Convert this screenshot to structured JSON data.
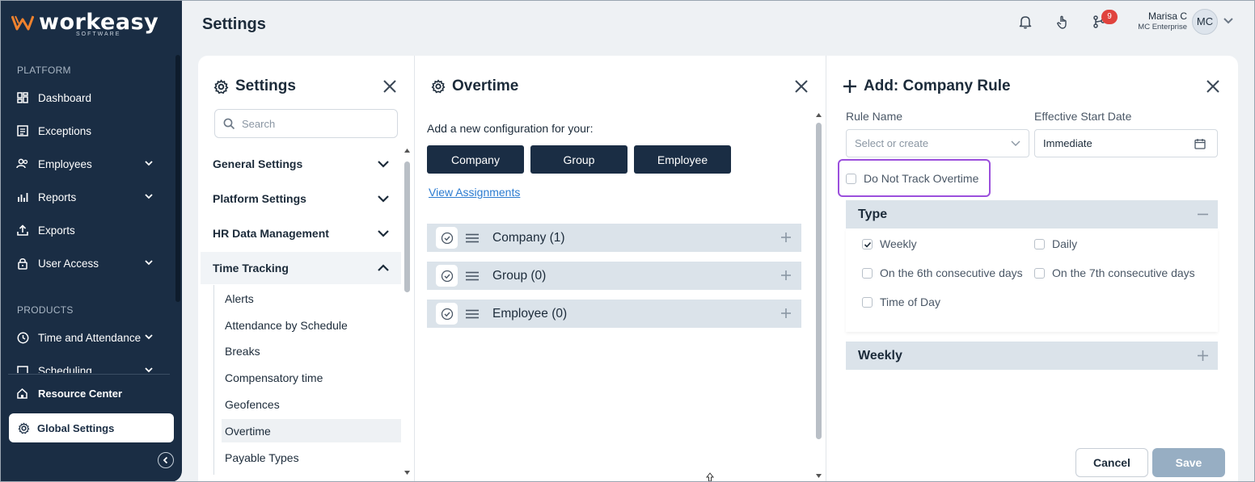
{
  "brand": {
    "name": "workeasy",
    "sub": "SOFTWARE",
    "accent": "#f0822e"
  },
  "sidebar": {
    "section_platform": "PLATFORM",
    "section_products": "PRODUCTS",
    "items": [
      {
        "label": "Dashboard",
        "icon": "dashboard-icon"
      },
      {
        "label": "Exceptions",
        "icon": "list-icon"
      },
      {
        "label": "Employees",
        "icon": "users-icon"
      },
      {
        "label": "Reports",
        "icon": "chart-icon"
      },
      {
        "label": "Exports",
        "icon": "upload-icon"
      },
      {
        "label": "User Access",
        "icon": "lock-icon"
      },
      {
        "label": "Time and Attendance",
        "icon": "clock-icon"
      },
      {
        "label": "Scheduling",
        "icon": "calendar-icon"
      }
    ],
    "resource_center": "Resource Center",
    "global_settings": "Global Settings"
  },
  "header": {
    "title": "Settings",
    "notification_count": "9",
    "user_name": "Marisa C",
    "user_org": "MC Enterprise",
    "avatar_initials": "MC"
  },
  "settings_panel": {
    "title": "Settings",
    "search_placeholder": "Search",
    "groups": [
      "General Settings",
      "Platform Settings",
      "HR Data Management",
      "Time Tracking"
    ],
    "time_tracking_items": [
      "Alerts",
      "Attendance by Schedule",
      "Breaks",
      "Compensatory time",
      "Geofences",
      "Overtime",
      "Payable Types"
    ]
  },
  "overtime_panel": {
    "title": "Overtime",
    "prompt": "Add a new configuration for your:",
    "buttons": [
      "Company",
      "Group",
      "Employee"
    ],
    "view_link": "View Assignments",
    "rows": [
      "Company (1)",
      "Group (0)",
      "Employee (0)"
    ]
  },
  "rule_panel": {
    "title": "Add: Company Rule",
    "rule_name_label": "Rule Name",
    "rule_name_placeholder": "Select or create",
    "start_date_label": "Effective Start Date",
    "start_date_value": "Immediate",
    "do_not_track": "Do Not Track Overtime",
    "type_header": "Type",
    "type_options": {
      "weekly": "Weekly",
      "daily": "Daily",
      "sixth": "On the 6th consecutive days",
      "seventh": "On the 7th consecutive days",
      "time_of_day": "Time of Day"
    },
    "weekly_header": "Weekly",
    "cancel": "Cancel",
    "save": "Save"
  }
}
